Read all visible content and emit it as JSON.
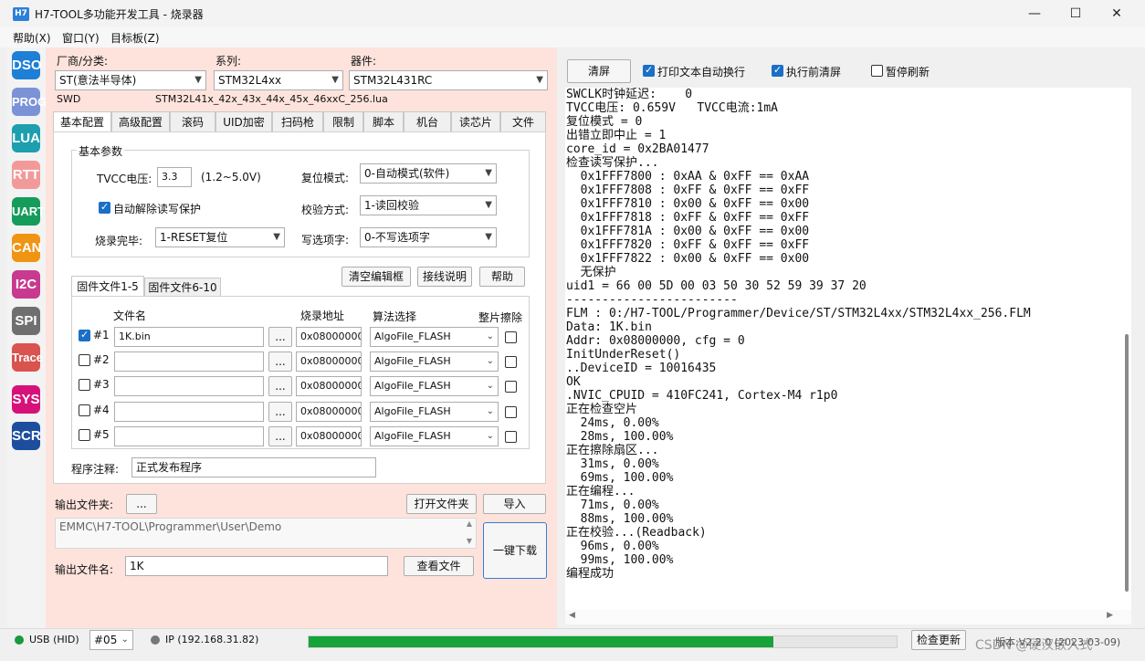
{
  "window": {
    "app_icon": "H7",
    "title": "H7-TOOL多功能开发工具 - 烧录器",
    "min": "—",
    "max": "☐",
    "close": "✕"
  },
  "menu": [
    "帮助(X)",
    "窗口(Y)",
    "目标板(Z)"
  ],
  "sidebar": [
    {
      "label": "DSO",
      "color": "#1e7fd6"
    },
    {
      "label": "PROG",
      "color": "#7b93d6"
    },
    {
      "label": "LUA",
      "color": "#1d9fb0"
    },
    {
      "label": "RTT",
      "color": "#f29a9a"
    },
    {
      "label": "UART",
      "color": "#159c5b"
    },
    {
      "label": "CAN",
      "color": "#f09414"
    },
    {
      "label": "I2C",
      "color": "#c83a8f"
    },
    {
      "label": "SPI",
      "color": "#6f6f6f"
    },
    {
      "label": "Trace",
      "color": "#d9534f"
    },
    {
      "label": "SYS",
      "color": "#d6127a"
    },
    {
      "label": "SCR",
      "color": "#1d4e9e"
    }
  ],
  "device": {
    "vendor_label": "厂商/分类:",
    "vendor_value": "ST(意法半导体)",
    "series_label": "系列:",
    "series_value": "STM32L4xx",
    "part_label": "器件:",
    "part_value": "STM32L431RC",
    "interface": "SWD",
    "lua_file": "STM32L41x_42x_43x_44x_45x_46xxC_256.lua"
  },
  "tabs": [
    "基本配置",
    "高级配置",
    "滚码",
    "UID加密",
    "扫码枪",
    "限制",
    "脚本",
    "机台",
    "读芯片",
    "文件"
  ],
  "basic": {
    "group_title": "基本参数",
    "tvcc_label": "TVCC电压:",
    "tvcc_value": "3.3",
    "tvcc_range": "(1.2~5.0V)",
    "reset_label": "复位模式:",
    "reset_value": "0-自动模式(软件)",
    "auto_unlock_label": "自动解除读写保护",
    "verify_label": "校验方式:",
    "verify_value": "1-读回校验",
    "done_label": "烧录完毕:",
    "done_value": "1-RESET复位",
    "option_label": "写选项字:",
    "option_value": "0-不写选项字"
  },
  "files": {
    "subtab1": "固件文件1-5",
    "subtab2": "固件文件6-10",
    "clear_btn": "清空编辑框",
    "wiring_btn": "接线说明",
    "help_btn": "帮助",
    "col_name": "文件名",
    "col_addr": "烧录地址",
    "col_algo": "算法选择",
    "col_erase": "整片擦除",
    "browse": "...",
    "rows": [
      {
        "id": "#1",
        "checked": true,
        "file": "1K.bin",
        "addr": "0x08000000",
        "algo": "AlgoFile_FLASH"
      },
      {
        "id": "#2",
        "checked": false,
        "file": "",
        "addr": "0x08000000",
        "algo": "AlgoFile_FLASH"
      },
      {
        "id": "#3",
        "checked": false,
        "file": "",
        "addr": "0x08000000",
        "algo": "AlgoFile_FLASH"
      },
      {
        "id": "#4",
        "checked": false,
        "file": "",
        "addr": "0x08000000",
        "algo": "AlgoFile_FLASH"
      },
      {
        "id": "#5",
        "checked": false,
        "file": "",
        "addr": "0x08000000",
        "algo": "AlgoFile_FLASH"
      }
    ],
    "note_label": "程序注释:",
    "note_value": "正式发布程序"
  },
  "output": {
    "folder_label": "输出文件夹:",
    "folder_btn": "...",
    "open_folder_btn": "打开文件夹",
    "import_btn": "导入",
    "path": "EMMC\\H7-TOOL\\Programmer\\User\\Demo",
    "one_key_btn": "一键下载",
    "filename_label": "输出文件名:",
    "filename_value": "1K",
    "view_file_btn": "查看文件"
  },
  "log_toolbar": {
    "clear_btn": "清屏",
    "wrap_label": "打印文本自动换行",
    "wrap_checked": true,
    "preclear_label": "执行前清屏",
    "preclear_checked": true,
    "pause_label": "暂停刷新",
    "pause_checked": false
  },
  "log_lines": [
    "SWCLK时钟延迟:    0",
    "TVCC电压: 0.659V   TVCC电流:1mA",
    "复位模式 = 0",
    "出错立即中止 = 1",
    "core_id = 0x2BA01477",
    "检查读写保护...",
    "  0x1FFF7800 : 0xAA & 0xFF == 0xAA",
    "  0x1FFF7808 : 0xFF & 0xFF == 0xFF",
    "  0x1FFF7810 : 0x00 & 0xFF == 0x00",
    "  0x1FFF7818 : 0xFF & 0xFF == 0xFF",
    "  0x1FFF781A : 0x00 & 0xFF == 0x00",
    "  0x1FFF7820 : 0xFF & 0xFF == 0xFF",
    "  0x1FFF7822 : 0x00 & 0xFF == 0x00",
    "  无保护",
    "uid1 = 66 00 5D 00 03 50 30 52 59 39 37 20",
    "------------------------",
    "FLM : 0:/H7-TOOL/Programmer/Device/ST/STM32L4xx/STM32L4xx_256.FLM",
    "Data: 1K.bin",
    "Addr: 0x08000000, cfg = 0",
    "InitUnderReset()",
    "..DeviceID = 10016435",
    "OK",
    ".NVIC_CPUID = 410FC241, Cortex-M4 r1p0",
    "正在检查空片",
    "  24ms, 0.00%",
    "  28ms, 100.00%",
    "正在擦除扇区...",
    "  31ms, 0.00%",
    "  69ms, 100.00%",
    "正在编程...",
    "  71ms, 0.00%",
    "  88ms, 100.00%",
    "正在校验...(Readback)",
    "  96ms, 0.00%",
    "  99ms, 100.00%",
    "编程成功"
  ],
  "status": {
    "usb_label": "USB (HID)",
    "usb_color": "#1a9a3a",
    "port_value": "#05",
    "ip_label": "IP (192.168.31.82)",
    "ip_color": "#777777",
    "progress": 0.79,
    "progress_color": "#15a33a",
    "check_update_btn": "检查更新",
    "version": "版本:V2.2.0 (2023-03-09)",
    "watermark": "CSDN @硬汉嵌入式"
  }
}
